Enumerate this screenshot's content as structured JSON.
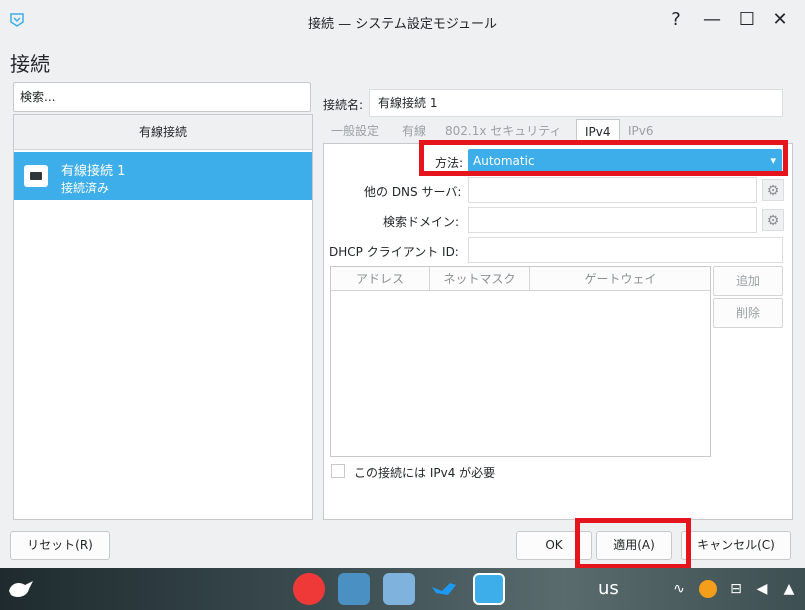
{
  "window": {
    "title": "接続 — システム設定モジュール",
    "help_glyph": "?",
    "minimize_glyph": "—",
    "maximize_glyph": "☐",
    "close_glyph": "✕"
  },
  "page_title": "接続",
  "search": {
    "placeholder": "検索..."
  },
  "connection_list": {
    "header": "有線接続",
    "items": [
      {
        "name": "有線接続 1",
        "status": "接続済み",
        "icon": "ethernet-icon",
        "selected": true
      }
    ]
  },
  "editor": {
    "conn_name_label": "接続名:",
    "conn_name_value": "有線接続 1",
    "tabs": [
      "一般設定",
      "有線",
      "802.1x セキュリティ",
      "IPv4",
      "IPv6"
    ],
    "active_tab": "IPv4",
    "method_label": "方法:",
    "method_value": "Automatic",
    "dns_label": "他の DNS サーバ:",
    "search_domain_label": "検索ドメイン:",
    "dhcp_label": "DHCP クライアント ID:",
    "table_columns": [
      "アドレス",
      "ネットマスク",
      "ゲートウェイ"
    ],
    "add_button": "追加",
    "remove_button": "削除",
    "require_ipv4_label": "この接続には IPv4 が必要",
    "require_ipv4_checked": false
  },
  "footer": {
    "reset_button": "リセット(R)",
    "ok_button": "OK",
    "apply_button": "適用(A)",
    "cancel_button": "キャンセル(C)"
  },
  "taskbar": {
    "keyboard_layout": "us",
    "apps": [
      "vivaldi-icon",
      "file-manager-icon",
      "document-icon",
      "bird-icon",
      "system-settings-icon"
    ],
    "tray": [
      "network-monitor-icon",
      "updates-icon",
      "network-icon",
      "volume-icon",
      "expand-tray-icon"
    ]
  },
  "colors": {
    "accent": "#3daee9",
    "highlight_box": "#e5141d",
    "window_bg": "#eff0f1"
  }
}
